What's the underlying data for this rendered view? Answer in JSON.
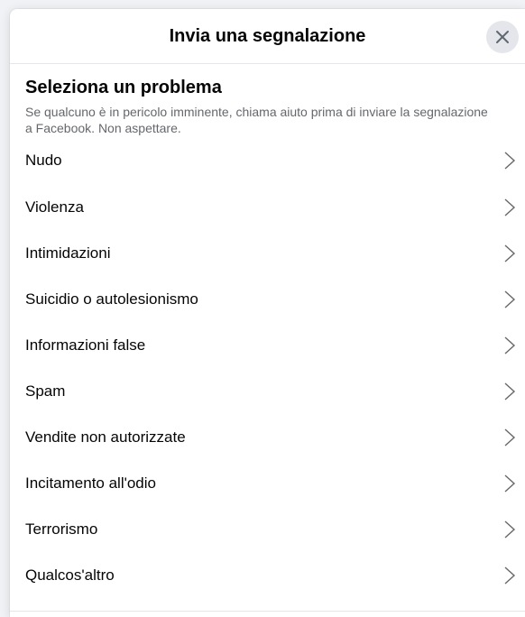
{
  "dialog": {
    "title": "Invia una segnalazione",
    "close_icon": "close-icon"
  },
  "section": {
    "title": "Seleziona un problema",
    "description": "Se qualcuno è in pericolo imminente, chiama aiuto prima di inviare la segnalazione a Facebook. Non aspettare."
  },
  "items": [
    {
      "label": "Nudo"
    },
    {
      "label": "Violenza"
    },
    {
      "label": "Intimidazioni"
    },
    {
      "label": "Suicidio o autolesionismo"
    },
    {
      "label": "Informazioni false"
    },
    {
      "label": "Spam"
    },
    {
      "label": "Vendite non autorizzate"
    },
    {
      "label": "Incitamento all'odio"
    },
    {
      "label": "Terrorismo"
    },
    {
      "label": "Qualcos'altro"
    }
  ],
  "colors": {
    "primary_text": "#050505",
    "secondary_text": "#65676b",
    "divider": "#e4e6eb",
    "background": "#f0f2f5"
  }
}
